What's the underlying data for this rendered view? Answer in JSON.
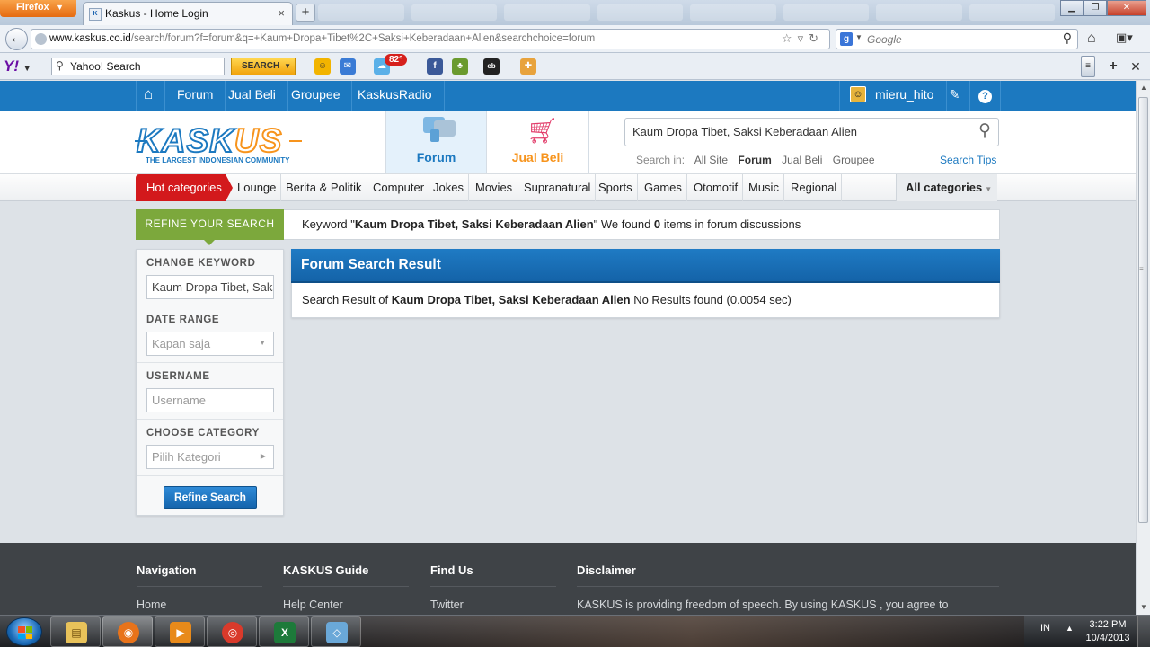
{
  "browser": {
    "app_button": "Firefox",
    "active_tab_title": "Kaskus - Home Login",
    "url_host": "www.kaskus.co.id",
    "url_path": "/search/forum?f=forum&q=+Kaum+Dropa+Tibet%2C+Saksi+Keberadaan+Alien&searchchoice=forum",
    "search_engine_placeholder": "Google"
  },
  "yahoo_toolbar": {
    "logo": "Y!",
    "search_value": "Yahoo! Search",
    "search_button": "SEARCH",
    "weather_badge": "82°"
  },
  "kaskus": {
    "topnav": {
      "items": [
        "Forum",
        "Jual Beli",
        "Groupee",
        "KaskusRadio"
      ],
      "username": "mieru_hito"
    },
    "header": {
      "logo_word_a": "KASK",
      "logo_word_b": "US",
      "logo_tagline": "THE LARGEST INDONESIAN COMMUNITY",
      "tab_forum": "Forum",
      "tab_jual_beli": "Jual Beli",
      "search_value": "Kaum Dropa Tibet, Saksi Keberadaan Alien",
      "search_in_label": "Search in:",
      "search_in_options": [
        "All Site",
        "Forum",
        "Jual Beli",
        "Groupee"
      ],
      "search_tips": "Search Tips"
    },
    "categories": {
      "hot": "Hot categories",
      "items": [
        "Lounge",
        "Berita & Politik",
        "Computer",
        "Jokes",
        "Movies",
        "Supranatural",
        "Sports",
        "Games",
        "Otomotif",
        "Music",
        "Regional"
      ],
      "all": "All categories"
    },
    "refine_banner": {
      "label": "REFINE YOUR SEARCH",
      "keyword_prefix": "Keyword \"",
      "keyword": "Kaum Dropa Tibet, Saksi Keberadaan Alien",
      "found_prefix": "\" We found ",
      "count": "0",
      "found_suffix": " items in forum discussions"
    },
    "sidebar": {
      "change_keyword_title": "CHANGE KEYWORD",
      "keyword_value": "Kaum Dropa Tibet, Saksi Keberadaan Alien",
      "date_range_title": "DATE RANGE",
      "date_range_value": "Kapan saja",
      "username_title": "USERNAME",
      "username_placeholder": "Username",
      "category_title": "CHOOSE CATEGORY",
      "category_value": "Pilih Kategori",
      "refine_button": "Refine Search"
    },
    "result": {
      "title": "Forum Search Result",
      "prefix": "Search Result of ",
      "keyword": "Kaum Dropa Tibet, Saksi Keberadaan Alien",
      "suffix": " No Results found (0.0054 sec)"
    },
    "footer": {
      "columns": [
        {
          "title": "Navigation",
          "first_link": "Home"
        },
        {
          "title": "KASKUS Guide",
          "first_link": "Help Center"
        },
        {
          "title": "Find Us",
          "first_link": "Twitter"
        },
        {
          "title": "Disclaimer",
          "first_link": "KASKUS is providing freedom of speech. By using KASKUS , you agree to"
        }
      ]
    }
  },
  "taskbar": {
    "language": "IN",
    "time": "3:22 PM",
    "date": "10/4/2013"
  }
}
